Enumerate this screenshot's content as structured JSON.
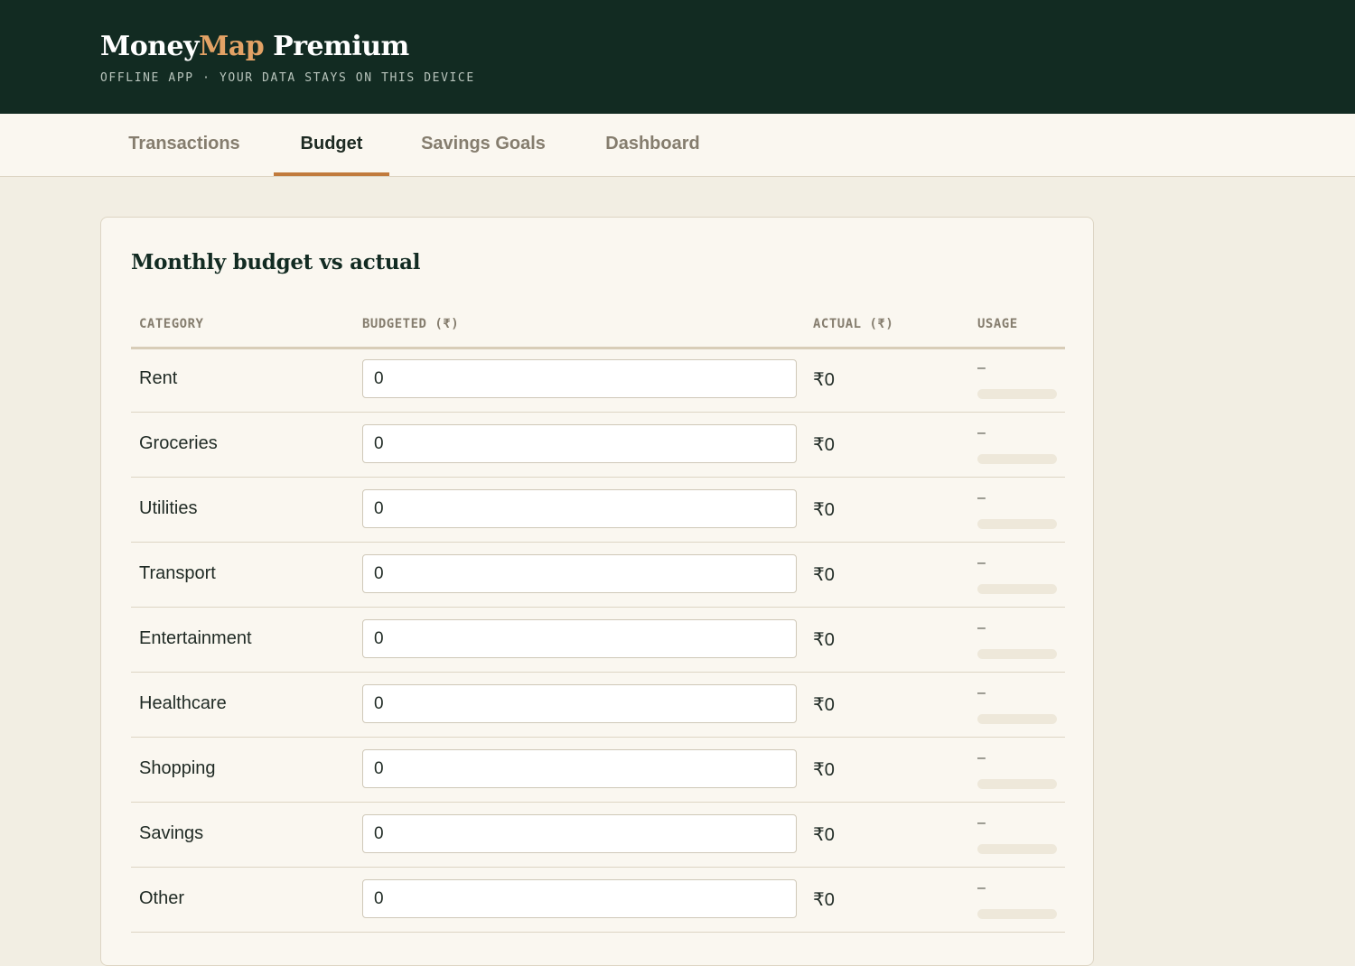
{
  "app": {
    "brand_primary": "Money",
    "brand_accent": "Map",
    "brand_suffix": " Premium",
    "tagline": "OFFLINE APP · YOUR DATA STAYS ON THIS DEVICE"
  },
  "tabs": [
    {
      "label": "Transactions",
      "active": false
    },
    {
      "label": "Budget",
      "active": true
    },
    {
      "label": "Savings Goals",
      "active": false
    },
    {
      "label": "Dashboard",
      "active": false
    }
  ],
  "budget": {
    "title": "Monthly budget vs actual",
    "columns": {
      "category": "CATEGORY",
      "budgeted": "BUDGETED (₹)",
      "actual": "ACTUAL (₹)",
      "usage": "USAGE"
    },
    "rows": [
      {
        "category": "Rent",
        "budgeted": "0",
        "actual": "₹0",
        "usage": "–",
        "usage_fraction": 0
      },
      {
        "category": "Groceries",
        "budgeted": "0",
        "actual": "₹0",
        "usage": "–",
        "usage_fraction": 0
      },
      {
        "category": "Utilities",
        "budgeted": "0",
        "actual": "₹0",
        "usage": "–",
        "usage_fraction": 0
      },
      {
        "category": "Transport",
        "budgeted": "0",
        "actual": "₹0",
        "usage": "–",
        "usage_fraction": 0
      },
      {
        "category": "Entertainment",
        "budgeted": "0",
        "actual": "₹0",
        "usage": "–",
        "usage_fraction": 0
      },
      {
        "category": "Healthcare",
        "budgeted": "0",
        "actual": "₹0",
        "usage": "–",
        "usage_fraction": 0
      },
      {
        "category": "Shopping",
        "budgeted": "0",
        "actual": "₹0",
        "usage": "–",
        "usage_fraction": 0
      },
      {
        "category": "Savings",
        "budgeted": "0",
        "actual": "₹0",
        "usage": "–",
        "usage_fraction": 0
      },
      {
        "category": "Other",
        "budgeted": "0",
        "actual": "₹0",
        "usage": "–",
        "usage_fraction": 0
      }
    ]
  },
  "colors": {
    "header_bg": "#122b22",
    "brand_accent": "#e3a265",
    "tab_underline": "#c17a3c",
    "page_bg": "#f2eee3",
    "card_bg": "#faf7f0"
  }
}
